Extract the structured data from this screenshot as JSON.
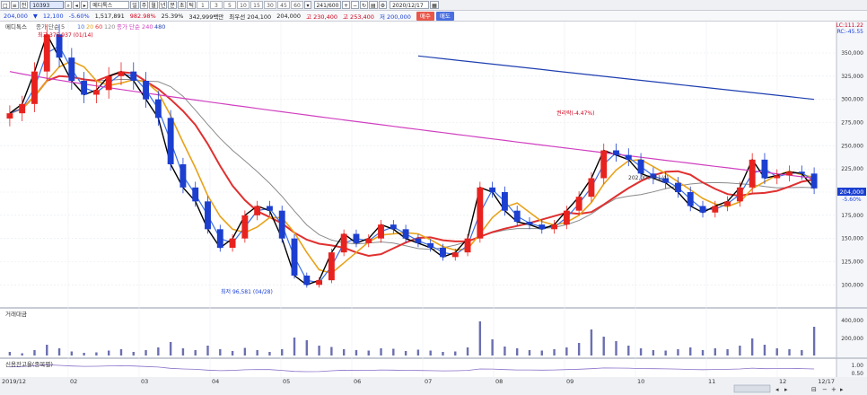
{
  "toolbar": {
    "stock_code": "10393",
    "stock_name": "메디톡스",
    "period_numbers": [
      "1",
      "3",
      "5",
      "10",
      "15",
      "30",
      "45",
      "60"
    ],
    "counter": "241/600",
    "date": "2020/12/17"
  },
  "quote": {
    "price": "204,000",
    "change": "12,100",
    "change_pct": "-5.60%",
    "volume": "1,517,891",
    "volume_pct": "982.98%",
    "turnover_pct": "25.39%",
    "trade_value": "342,999백만",
    "best_quote": "최우선 204,100",
    "open": "204,000",
    "high": "고 230,400",
    "high_alt": "고 253,400",
    "low": "저 200,000",
    "buy_label": "매수",
    "sell_label": "매도"
  },
  "price_panel": {
    "title": "메디톡스",
    "legend_ma": "종가 단순 5",
    "legend_ma_periods": [
      "10",
      "20",
      "60",
      "120"
    ],
    "legend_ma2": "종가 단순 240",
    "legend_ma2_period": "480",
    "top_right_1": "LC:111.22",
    "top_right_2": "RC:-45.55",
    "current_price_tag": "204,000",
    "current_change_tag": "-5.60%",
    "annotation_high": "최고 375,937 (01/14)",
    "annotation_low": "최저 96,581 (04/28)",
    "annotation_event": "권리락(-4.47%)",
    "annotation_mid": "202,000 (11/4)",
    "price_ticks": [
      "350,000",
      "325,000",
      "300,000",
      "275,000",
      "250,000",
      "225,000",
      "200,000",
      "175,000",
      "150,000",
      "125,000",
      "100,000"
    ]
  },
  "volume_panel": {
    "title": "거래대금",
    "ticks": [
      "400,000",
      "200,000"
    ]
  },
  "credit_panel": {
    "title": "신용잔고율(종목별)",
    "ticks": [
      "1.00",
      "0.50"
    ]
  },
  "x_axis": {
    "labels": [
      "2019/12",
      "02",
      "03",
      "04",
      "05",
      "06",
      "07",
      "08",
      "09",
      "10",
      "11",
      "12",
      "12/17"
    ]
  },
  "chart_data": {
    "type": "candlestick",
    "y_range": [
      80000,
      380000
    ],
    "colors": {
      "up": "#e8231f",
      "down": "#1c3fd0",
      "ma5": "#000000",
      "ma10": "#3a6fe0",
      "ma20": "#e8a21a",
      "ma60": "#e03030",
      "ma120": "#8a8a8a",
      "ma240": "#d040c0",
      "ma480": "#1f3fb0",
      "volume": "#6b6fb0",
      "credit": "#8a70c8"
    },
    "close_points": [
      [
        "2019/12",
        285000
      ],
      [
        "12",
        295000
      ],
      [
        "01",
        330000
      ],
      [
        "01",
        370000
      ],
      [
        "01",
        345000
      ],
      [
        "01",
        320000
      ],
      [
        "02",
        305000
      ],
      [
        "02",
        310000
      ],
      [
        "02",
        325000
      ],
      [
        "02",
        330000
      ],
      [
        "02",
        320000
      ],
      [
        "02",
        300000
      ],
      [
        "03",
        280000
      ],
      [
        "03",
        230000
      ],
      [
        "03",
        205000
      ],
      [
        "03",
        190000
      ],
      [
        "03",
        160000
      ],
      [
        "03",
        140000
      ],
      [
        "04",
        150000
      ],
      [
        "04",
        175000
      ],
      [
        "04",
        185000
      ],
      [
        "04",
        180000
      ],
      [
        "04",
        150000
      ],
      [
        "04",
        110000
      ],
      [
        "05",
        100000
      ],
      [
        "05",
        105000
      ],
      [
        "05",
        135000
      ],
      [
        "05",
        155000
      ],
      [
        "05",
        145000
      ],
      [
        "06",
        150000
      ],
      [
        "06",
        165000
      ],
      [
        "06",
        160000
      ],
      [
        "06",
        150000
      ],
      [
        "06",
        145000
      ],
      [
        "06",
        140000
      ],
      [
        "07",
        130000
      ],
      [
        "07",
        135000
      ],
      [
        "07",
        150000
      ],
      [
        "07",
        205000
      ],
      [
        "07",
        200000
      ],
      [
        "07",
        180000
      ],
      [
        "08",
        168000
      ],
      [
        "08",
        165000
      ],
      [
        "08",
        160000
      ],
      [
        "08",
        165000
      ],
      [
        "08",
        180000
      ],
      [
        "08",
        195000
      ],
      [
        "09",
        215000
      ],
      [
        "09",
        245000
      ],
      [
        "09",
        240000
      ],
      [
        "09",
        235000
      ],
      [
        "09",
        220000
      ],
      [
        "10",
        215000
      ],
      [
        "10",
        210000
      ],
      [
        "10",
        200000
      ],
      [
        "10",
        185000
      ],
      [
        "10",
        178000
      ],
      [
        "11",
        185000
      ],
      [
        "11",
        190000
      ],
      [
        "11",
        205000
      ],
      [
        "11",
        235000
      ],
      [
        "11",
        215000
      ],
      [
        "12",
        218000
      ],
      [
        "12",
        222000
      ],
      [
        "12",
        220000
      ],
      [
        "12/17",
        204000
      ]
    ],
    "volume_values": [
      40,
      25,
      60,
      120,
      80,
      45,
      30,
      35,
      55,
      70,
      40,
      60,
      90,
      150,
      80,
      60,
      110,
      70,
      50,
      85,
      60,
      40,
      70,
      200,
      170,
      110,
      95,
      70,
      60,
      55,
      80,
      75,
      50,
      65,
      55,
      40,
      45,
      90,
      380,
      180,
      100,
      80,
      60,
      55,
      70,
      90,
      140,
      290,
      210,
      160,
      110,
      80,
      60,
      55,
      70,
      90,
      60,
      80,
      70,
      110,
      190,
      120,
      80,
      70,
      60,
      320
    ]
  }
}
